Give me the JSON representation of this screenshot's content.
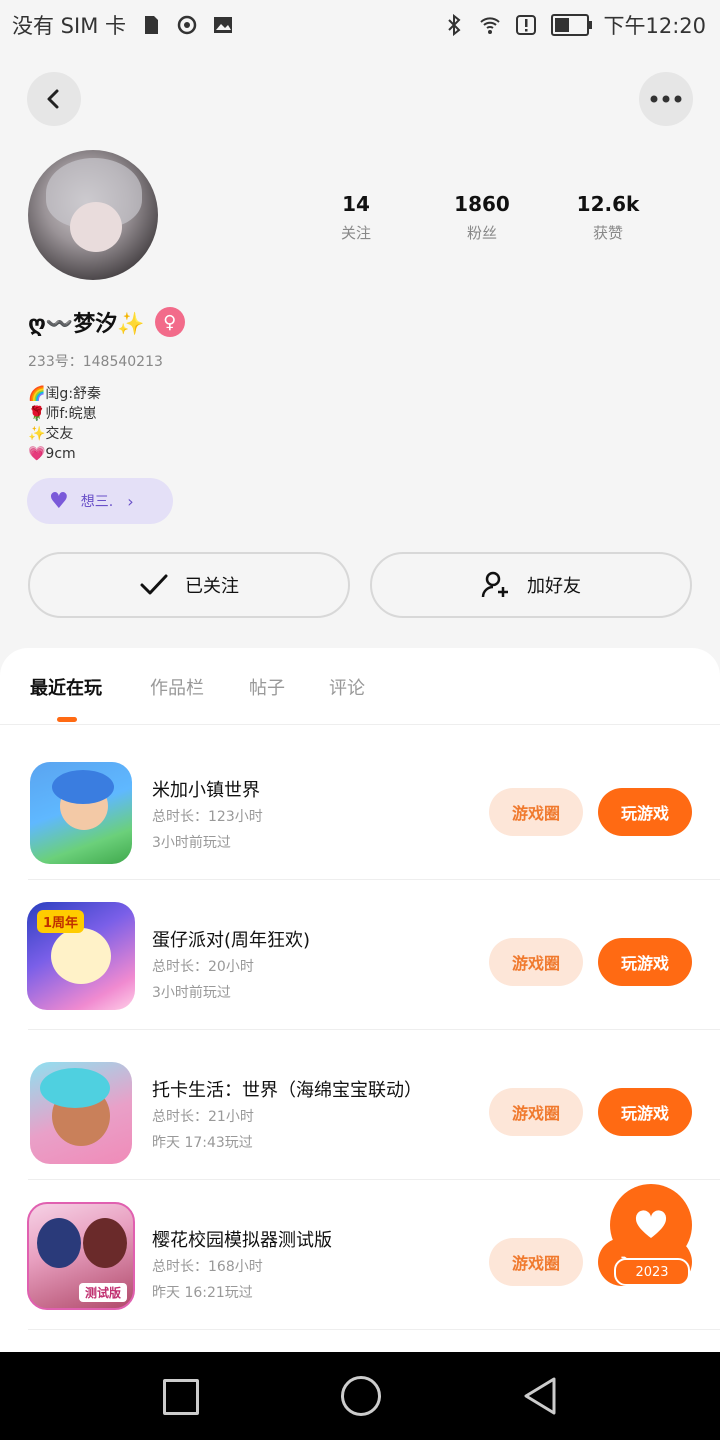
{
  "status_bar": {
    "carrier": "没有 SIM 卡",
    "time": "下午12:20",
    "battery_level": 0.45,
    "icons": [
      "sd-card-icon",
      "hotspot-icon",
      "image-icon",
      "bluetooth-icon",
      "wifi-icon",
      "alert-icon",
      "battery-icon"
    ]
  },
  "header": {
    "back_icon": "chevron-left-icon",
    "more_icon": "more-dots-icon"
  },
  "profile": {
    "stats": [
      {
        "value": "14",
        "label": "关注"
      },
      {
        "value": "1860",
        "label": "粉丝"
      },
      {
        "value": "12.6k",
        "label": "获赞"
      }
    ],
    "name": "ღ〰️梦汐✨",
    "gender_symbol": "♀",
    "uid": "233号：148540213",
    "bio": [
      "🌈闺g:舒秦",
      "🌹师f:皖崽",
      "✨交友",
      "💗9cm"
    ],
    "tag_label": "想三.",
    "followed_label": "已关注",
    "add_friend_label": "加好友"
  },
  "tabs": [
    {
      "label": "最近在玩",
      "active": true
    },
    {
      "label": "作品栏",
      "active": false
    },
    {
      "label": "帖子",
      "active": false
    },
    {
      "label": "评论",
      "active": false
    }
  ],
  "games": [
    {
      "title": "米加小镇世界",
      "duration": "总时长：123小时",
      "last_played": "3小时前玩过"
    },
    {
      "title": "蛋仔派对(周年狂欢)",
      "duration": "总时长：20小时",
      "last_played": "3小时前玩过",
      "icon_badge": "1周年"
    },
    {
      "title": "托卡生活：世界（海绵宝宝联动）",
      "duration": "总时长：21小时",
      "last_played": "昨天 17:43玩过"
    },
    {
      "title": "樱花校园模拟器测试版",
      "duration": "总时长：168小时",
      "last_played": "昨天 16:21玩过",
      "icon_badge": "测试版"
    }
  ],
  "game_actions": {
    "circle_label": "游戏圈",
    "play_label": "玩游戏"
  },
  "floating_badge": {
    "year": "2023",
    "icon": "heart-icon"
  },
  "accent_color": "#ff6a13"
}
